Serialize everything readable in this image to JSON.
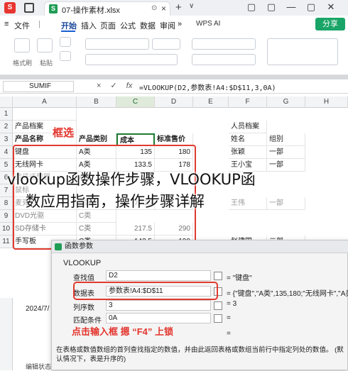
{
  "tabbar": {
    "app_icon": "S",
    "home_label": "",
    "file_tab_icon": "S",
    "file_name": "07-操作素材.xlsx",
    "pin_icon": "pin-icon",
    "close_icon": "×",
    "new_tab": "+",
    "chevron": "∨",
    "win": [
      "▢",
      "▢",
      "—",
      "▢",
      "✕"
    ]
  },
  "menubar": {
    "menu_icon": "≡",
    "file": "文件",
    "items": [
      "开始",
      "插入",
      "页面",
      "公式",
      "数据",
      "审阅"
    ],
    "more": "»",
    "wps_ai": "WPS AI",
    "share": "分享"
  },
  "ribbon": {
    "labels": [
      "格式刷",
      "粘贴"
    ]
  },
  "formulabar": {
    "namebox": "SUMIF",
    "cancel": "×",
    "confirm": "✓",
    "fx": "fx",
    "formula": "=VLOOKUP(D2,参数表!A4:$D$11,3,0A)"
  },
  "sheet": {
    "columns": [
      "A",
      "B",
      "C",
      "D",
      "E",
      "F",
      "G",
      "H"
    ],
    "rows": [
      "1",
      "2",
      "3",
      "4",
      "5",
      "6",
      "7",
      "8",
      "9",
      "10",
      "11"
    ],
    "a2": "产品档案",
    "f2": "人员档案",
    "headers": [
      "产品名称",
      "产品类别",
      "成本",
      "标准售价"
    ],
    "staff_headers": [
      "姓名",
      "组别"
    ],
    "products": [
      {
        "name": "键盘",
        "cat": "A类",
        "cost": "135",
        "price": "180"
      },
      {
        "name": "无线网卡",
        "cat": "A类",
        "cost": "133.5",
        "price": "178"
      },
      {
        "name": "蓝牙适配器",
        "cat": "A类",
        "cost": "",
        "price": ""
      },
      {
        "name": "鼠标",
        "cat": "",
        "cost": "",
        "price": ""
      },
      {
        "name": "麦克风",
        "cat": "B类",
        "cost": "74.25",
        "price": "99"
      },
      {
        "name": "DVD光驱",
        "cat": "C类",
        "cost": "",
        "price": ""
      },
      {
        "name": "SD存储卡",
        "cat": "C类",
        "cost": "217.5",
        "price": "290"
      },
      {
        "name": "手写板",
        "cat": "C类",
        "cost": "142.5",
        "price": "190"
      }
    ],
    "staff": [
      {
        "name": "张颖",
        "group": "一部"
      },
      {
        "name": "王小宝",
        "group": "一部"
      },
      {
        "name": "",
        "group": ""
      },
      {
        "name": "",
        "group": ""
      },
      {
        "name": "王伟",
        "group": "一部"
      },
      {
        "name": "",
        "group": ""
      },
      {
        "name": "",
        "group": ""
      },
      {
        "name": "赵建国",
        "group": "二部"
      }
    ],
    "annotation_select": "框选"
  },
  "overlay": {
    "line1": "vlookup函数操作步骤，VLOOKUP函",
    "line2": "数应用指南，操作步骤详解"
  },
  "dialog": {
    "title": "函数参数",
    "func": "VLOOKUP",
    "fields": [
      {
        "label": "查找值",
        "value": "D2",
        "result": "= \"键盘\""
      },
      {
        "label": "数据表",
        "value": "参数表!A4:$D$11",
        "result": "= {\"键盘\",\"A类\",135,180;\"无线网卡\",\"A类\""
      },
      {
        "label": "列序数",
        "value": "3",
        "result": "= 3"
      },
      {
        "label": "匹配条件",
        "value": "0A",
        "result": "="
      }
    ],
    "equals": "=",
    "annotation": "点击输入框 摁 “F4” 上锁",
    "description": "在表格或数值数组的首列查找指定的数值，并由此返回表格或数组当前行中指定列处的数值。 (默认情况下，表是升序的)"
  },
  "leftcol": {
    "date": "2024/7/",
    "bottom": "编辑状态"
  }
}
